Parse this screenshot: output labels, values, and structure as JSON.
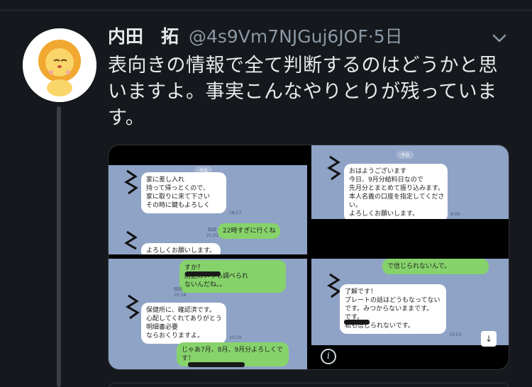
{
  "tweet": {
    "display_name": "内田　拓",
    "handle": "@4s9Vm7NJGuj6JOF",
    "separator": "·",
    "time": "5日",
    "text_lines": [
      "表向きの情報で全て判断するのはどうかと思",
      "いますよ。事実こんなやりとりが残っていま",
      "す。"
    ],
    "avatar_icon": "lion-avatar-icon",
    "menu_icon": "chevron-down-icon"
  },
  "media": {
    "info_icon": "i",
    "scroll_down_icon": "↓",
    "chat1": {
      "date_pill": "今日",
      "bubble_lines": [
        "家に差し入れ",
        "持って帰っとくので、",
        "家に取りに来て下さい",
        "その時に鍵もよろしく"
      ],
      "time1": "18:27",
      "read_label": "既読",
      "time2": "21:02",
      "green_text": "22時すぎに行くね",
      "bubble2": "よろしくお願いします。"
    },
    "chat2": {
      "date_pill": "今日",
      "bubble_lines": [
        "おはようございます",
        "今日、9月分給料日なので",
        "先月分とまとめて振り込みます。",
        "本人名義の口座を指定してくださ",
        "い。",
        "よろしくお願いします。"
      ],
      "time": "9:09"
    },
    "chat3": {
      "green_top_lines": [
        "すか？",
        "防犯カメラも調べられ",
        "ないんだね。。"
      ],
      "read_label": "既読",
      "time1": "10:18",
      "bubble_lines": [
        "保健所に、確認済です。",
        "心配してくれてありがとう",
        "明細書必要",
        "ならおくりますよ。"
      ],
      "time2": "10:19",
      "green_bottom_lines": [
        "じゃあ7月、8月、9月分よろしくで",
        "す！"
      ]
    },
    "chat4": {
      "green_top": "で信じられないんで。",
      "bubble_lines": [
        "了解です！",
        "プレートの話はどうもなってない",
        "です。みつからないままです。",
        "です。",
        "私も信じられないです。"
      ],
      "time": "10:53"
    }
  },
  "colors": {
    "background": "#15181c",
    "text": "#e7e9ea",
    "muted": "#8b98a5",
    "line_bg": "#8ea3c6",
    "line_green": "#86d36b"
  }
}
